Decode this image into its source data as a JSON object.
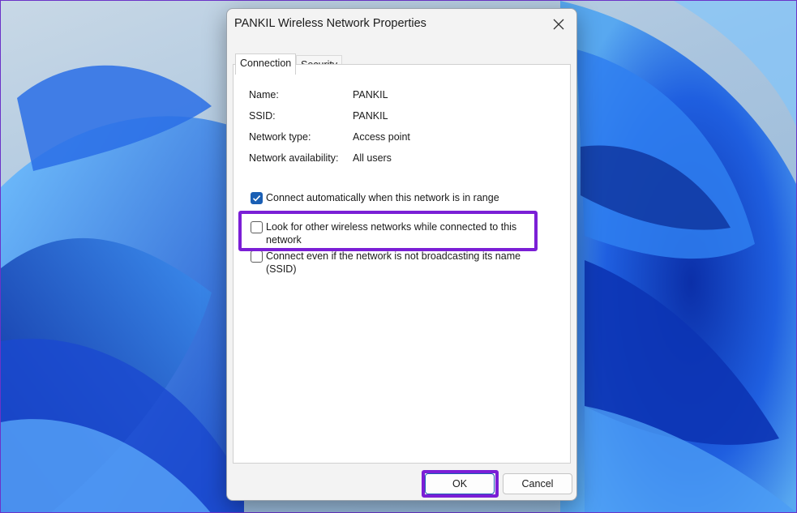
{
  "dialog": {
    "title": "PANKIL Wireless Network Properties",
    "close_glyph": "✕"
  },
  "tabs": [
    {
      "label": "Connection",
      "active": true
    },
    {
      "label": "Security",
      "active": false
    }
  ],
  "properties": [
    {
      "key": "Name:",
      "value": "PANKIL"
    },
    {
      "key": "SSID:",
      "value": "PANKIL"
    },
    {
      "key": "Network type:",
      "value": "Access point"
    },
    {
      "key": "Network availability:",
      "value": "All users"
    }
  ],
  "options": [
    {
      "label": "Connect automatically when this network is in range",
      "checked": true
    },
    {
      "label": "Look for other wireless networks while connected to this network",
      "checked": false
    },
    {
      "label": "Connect even if the network is not broadcasting its name (SSID)",
      "checked": false
    }
  ],
  "buttons": {
    "ok": "OK",
    "cancel": "Cancel"
  },
  "colors": {
    "highlight": "#7b1fd6",
    "checkbox_checked": "#1a5fb4"
  }
}
